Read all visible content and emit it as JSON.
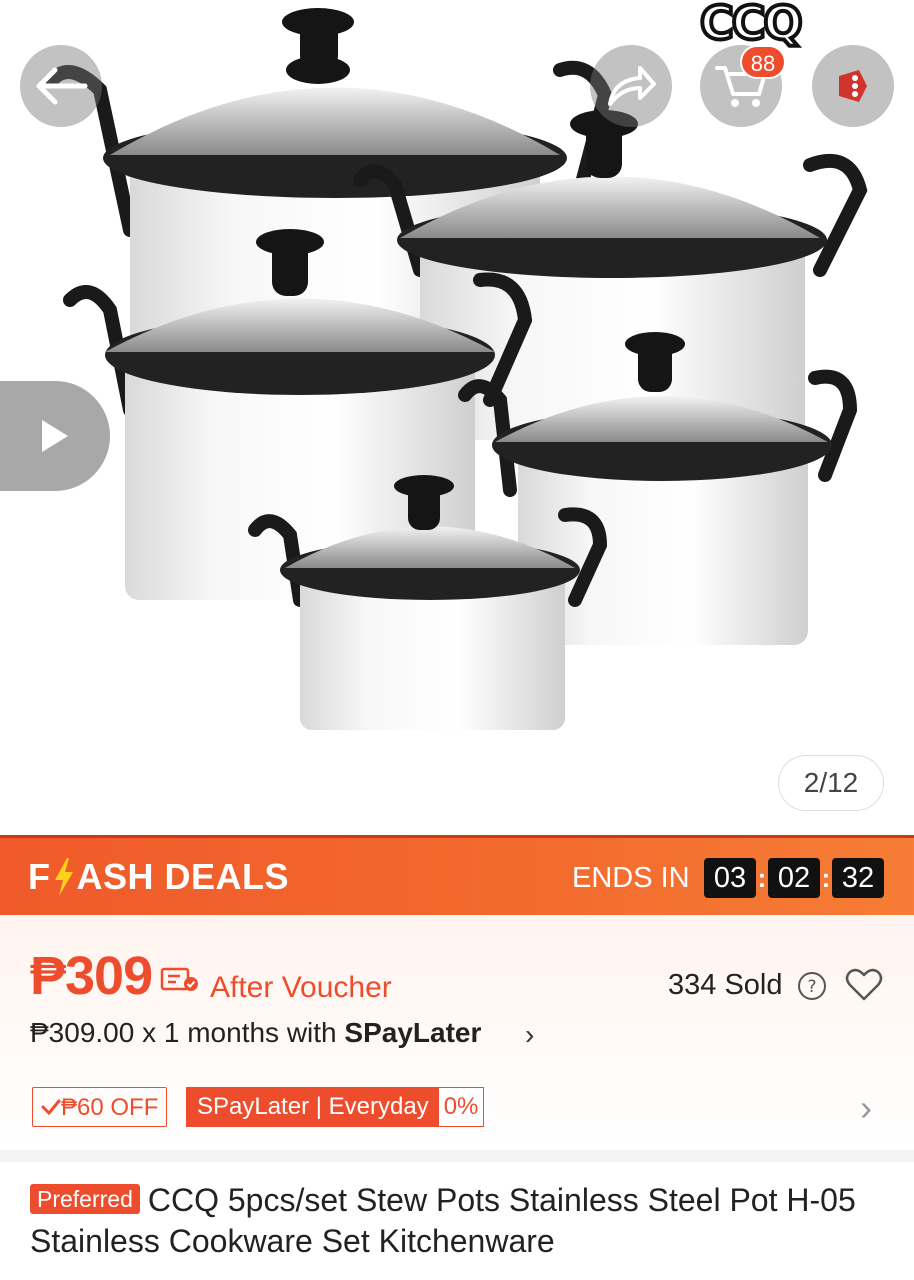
{
  "header": {
    "brand_logo_text": "CCQ",
    "cart_count": "88",
    "icons": [
      "back-arrow-icon",
      "share-icon",
      "cart-icon",
      "more-icon",
      "play-icon"
    ]
  },
  "gallery": {
    "counter": "2/12"
  },
  "flash_deals": {
    "title_prefix": "F",
    "title_suffix": "ASH DEALS",
    "ends_label": "ENDS IN",
    "hours": "03",
    "minutes": "02",
    "seconds": "32",
    "separator": ":"
  },
  "pricing": {
    "price": "₱309",
    "after_voucher": "After Voucher",
    "sold": "334 Sold",
    "installment_text": "₱309.00 x 1 months with ",
    "installment_brand": "SPayLater",
    "chevron": "›"
  },
  "tags": {
    "off_label": "₱60 OFF",
    "spay_label": "SPayLater | Everyday",
    "spay_pct": "0%"
  },
  "product": {
    "badge": "Preferred",
    "title": "CCQ  5pcs/set Stew Pots Stainless Steel Pot H-05 Stainless Cookware Set Kitchenware"
  },
  "colors": {
    "accent": "#ee4d2d",
    "flash_bar": "#f36b2e",
    "timer_box": "#111111"
  }
}
